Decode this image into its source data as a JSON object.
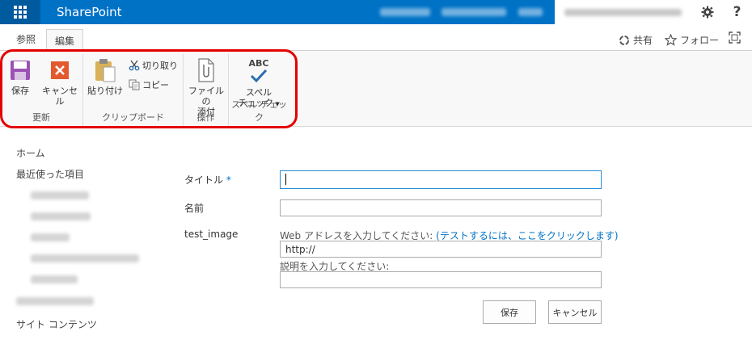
{
  "suite": {
    "brand": "SharePoint",
    "settings_icon": "gear-icon",
    "help_label": "?"
  },
  "tabs": [
    "参照",
    "編集"
  ],
  "actions": {
    "share": "共有",
    "follow": "フォロー"
  },
  "ribbon": {
    "update_group": {
      "label": "更新",
      "save": "保存",
      "cancel": "キャンセル"
    },
    "clipboard_group": {
      "label": "クリップボード",
      "paste": "貼り付け",
      "cut": "切り取り",
      "copy": "コピー"
    },
    "action_group": {
      "label": "操作",
      "attach_line1": "ファイルの",
      "attach_line2": "添付"
    },
    "spell_group": {
      "label": "スペル チェック",
      "abc": "ABC",
      "spell_line1": "スペル",
      "spell_line2": "チェック"
    }
  },
  "nav": {
    "home": "ホーム",
    "recent": "最近使った項目",
    "site_contents": "サイト コンテンツ"
  },
  "form": {
    "title_label": "タイトル",
    "required_mark": "*",
    "title_value": "",
    "name_label": "名前",
    "name_value": "",
    "image_label": "test_image",
    "url_hint": "Web アドレスを入力してください:",
    "url_test_link": "(テストするには、ここをクリックします)",
    "url_value": "http://",
    "desc_hint": "説明を入力してください:",
    "desc_value": "",
    "save_button": "保存",
    "cancel_button": "キャンセル"
  },
  "colors": {
    "suite_blue": "#0072c6",
    "accent_red": "#e40000"
  }
}
